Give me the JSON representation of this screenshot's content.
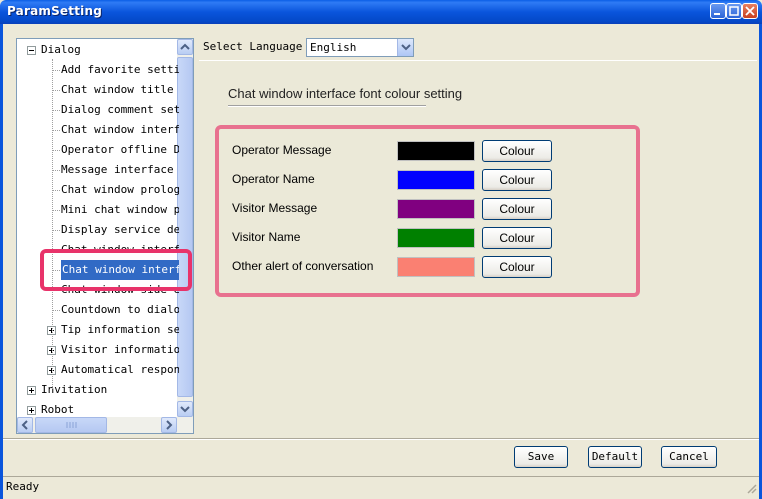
{
  "window": {
    "title": "ParamSetting"
  },
  "tree": {
    "items": [
      {
        "label": "Dialog",
        "level": 0,
        "expander": "minus"
      },
      {
        "label": "Add favorite setting",
        "level": 1
      },
      {
        "label": "Chat window title se",
        "level": 1
      },
      {
        "label": "Dialog comment setti",
        "level": 1
      },
      {
        "label": "Chat window interfac",
        "level": 1
      },
      {
        "label": "Operator offline Dis",
        "level": 1
      },
      {
        "label": "Message interface se",
        "level": 1
      },
      {
        "label": "Chat window prologue",
        "level": 1
      },
      {
        "label": "Mini chat window pro",
        "level": 1
      },
      {
        "label": "Display service depa",
        "level": 1
      },
      {
        "label": "Chat window interfac",
        "level": 1
      },
      {
        "label": "Chat window interfac",
        "level": 1,
        "selected": true
      },
      {
        "label": "Chat window side edg",
        "level": 1
      },
      {
        "label": "Countdown to dialog",
        "level": 1
      },
      {
        "label": "Tip information sett",
        "level": 1,
        "expander": "plus"
      },
      {
        "label": "Visitor information",
        "level": 1,
        "expander": "plus"
      },
      {
        "label": "Automatical response",
        "level": 1,
        "expander": "plus"
      },
      {
        "label": "Invitation",
        "level": 0,
        "expander": "plus"
      },
      {
        "label": "Robot",
        "level": 0,
        "expander": "plus"
      }
    ]
  },
  "language": {
    "label": "Select Language",
    "value": "English"
  },
  "section": {
    "title": "Chat window interface font colour setting"
  },
  "colors": [
    {
      "name": "Operator Message",
      "color": "#000000",
      "button": "Colour"
    },
    {
      "name": "Operator Name",
      "color": "#0000ff",
      "button": "Colour"
    },
    {
      "name": "Visitor Message",
      "color": "#800080",
      "button": "Colour"
    },
    {
      "name": "Visitor Name",
      "color": "#008000",
      "button": "Colour"
    },
    {
      "name": "Other alert of conversation",
      "color": "#fa8072",
      "button": "Colour"
    }
  ],
  "actions": {
    "save": "Save",
    "default": "Default",
    "cancel": "Cancel"
  },
  "status": {
    "text": "Ready"
  },
  "accent": {
    "highlight": "#e8336a",
    "selection": "#316ac5"
  }
}
